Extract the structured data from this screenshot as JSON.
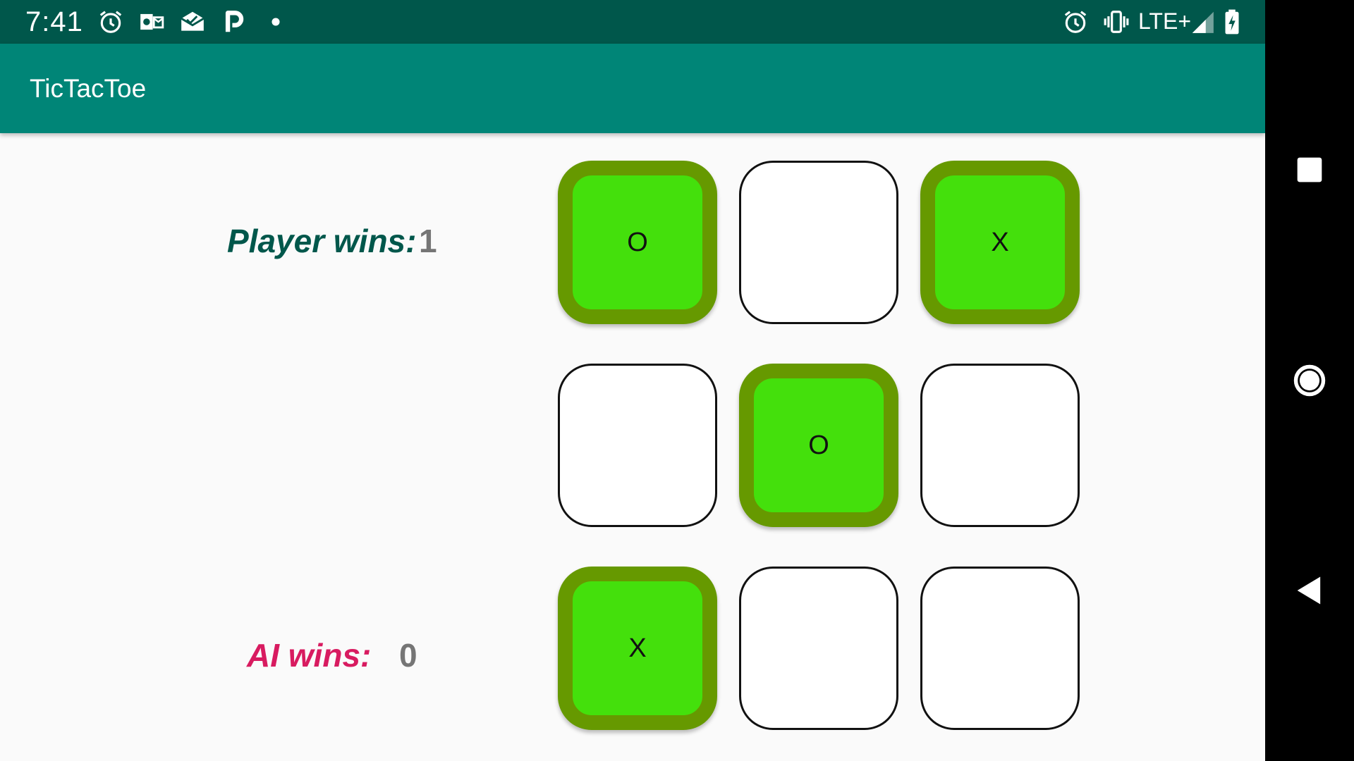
{
  "status_bar": {
    "time": "7:41",
    "left_icons": [
      "alarm-icon",
      "outlook-icon",
      "mail-icon",
      "p-app-icon",
      "notification-dot-icon"
    ],
    "right_icons": [
      "alarm-icon",
      "vibrate-icon",
      "signal-icon",
      "battery-charging-icon"
    ],
    "network": "LTE+"
  },
  "app_bar": {
    "title": "TicTacToe"
  },
  "scores": {
    "player_label": "Player wins:",
    "player_value": "1",
    "ai_label": "AI wins:",
    "ai_value": "0"
  },
  "board": {
    "cells": [
      "O",
      "",
      "X",
      "",
      "O",
      "",
      "X",
      "",
      ""
    ],
    "marked_cells": [
      true,
      false,
      true,
      false,
      true,
      false,
      true,
      false,
      false
    ]
  },
  "colors": {
    "status_bar": "#00574b",
    "app_bar": "#008577",
    "player_label": "#00574b",
    "ai_label": "#d81b60",
    "marked_fill": "#44e00c",
    "marked_border": "#669900"
  },
  "nav_bar": {
    "buttons": [
      "recents-button",
      "home-button",
      "back-button"
    ]
  }
}
